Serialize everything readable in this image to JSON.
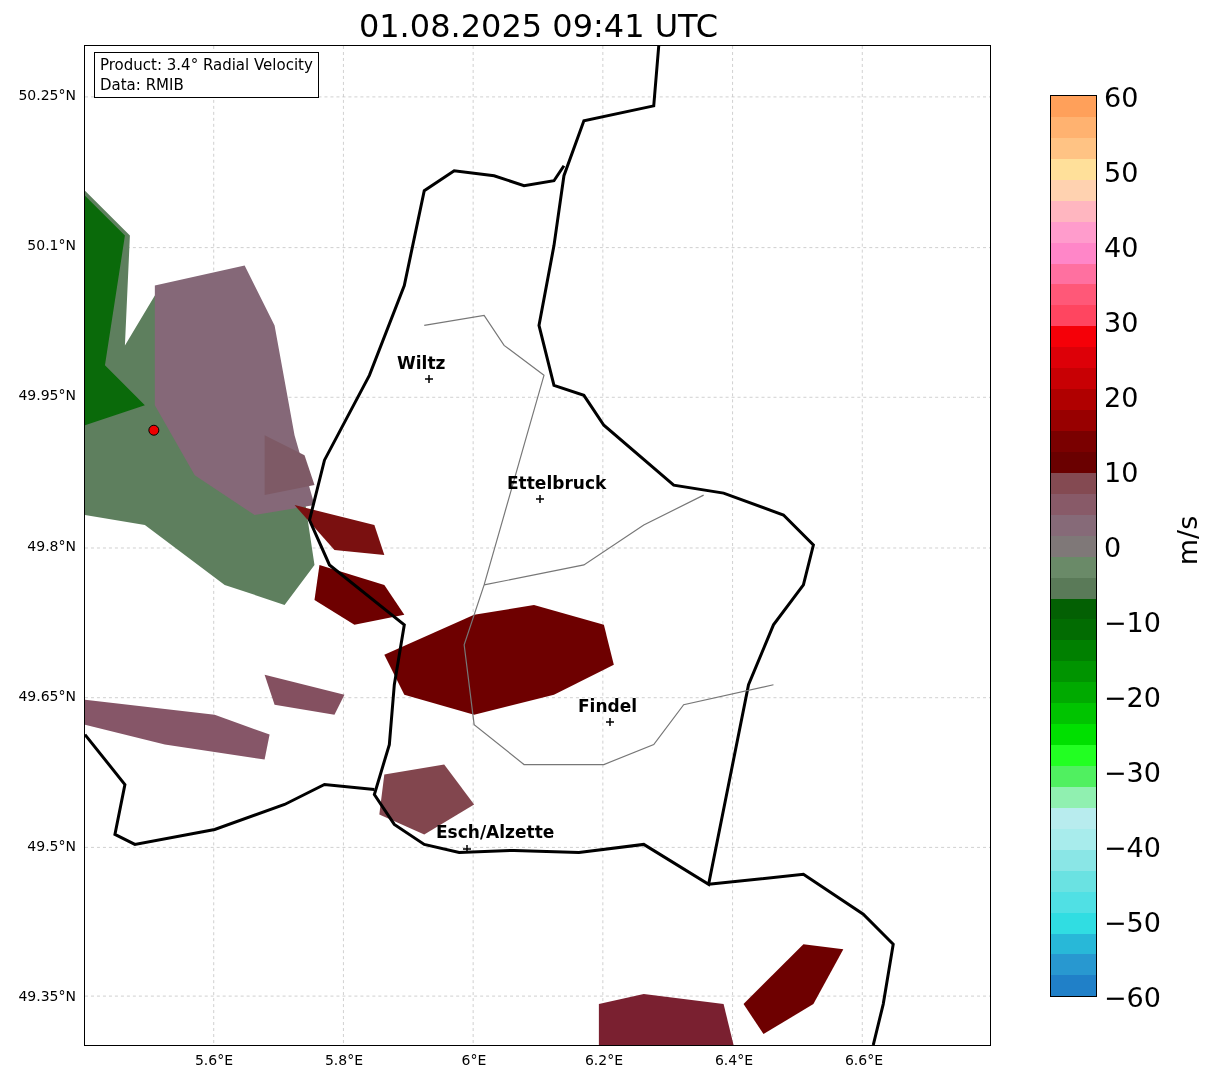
{
  "title": "01.08.2025 09:41 UTC",
  "legend": [
    "Product: 3.4° Radial Velocity",
    "Data: RMIB"
  ],
  "y_ticks": [
    "50.25°N",
    "50.1°N",
    "49.95°N",
    "49.8°N",
    "49.65°N",
    "49.5°N",
    "49.35°N"
  ],
  "x_ticks": [
    "5.6°E",
    "5.8°E",
    "6°E",
    "6.2°E",
    "6.4°E",
    "6.6°E"
  ],
  "cities": [
    {
      "name": "Wiltz"
    },
    {
      "name": "Ettelbruck"
    },
    {
      "name": "Findel"
    },
    {
      "name": "Esch/Alzette"
    }
  ],
  "colorbar": {
    "label": "m/s",
    "ticks": [
      "60",
      "50",
      "40",
      "30",
      "20",
      "10",
      "0",
      "−10",
      "−20",
      "−30",
      "−40",
      "−50",
      "−60"
    ],
    "bands": [
      {
        "color": "#ffa05a"
      },
      {
        "color": "#ffb270"
      },
      {
        "color": "#ffc384"
      },
      {
        "color": "#ffe09a"
      },
      {
        "color": "#ffd2b0"
      },
      {
        "color": "#ffb6c0"
      },
      {
        "color": "#ff9ccc"
      },
      {
        "color": "#ff86c8"
      },
      {
        "color": "#ff70a0"
      },
      {
        "color": "#ff5878"
      },
      {
        "color": "#ff4560"
      },
      {
        "color": "#f50008"
      },
      {
        "color": "#dd0008"
      },
      {
        "color": "#c80004"
      },
      {
        "color": "#b00000"
      },
      {
        "color": "#980000"
      },
      {
        "color": "#7a0000"
      },
      {
        "color": "#6a0000"
      },
      {
        "color": "#844a52"
      },
      {
        "color": "#885a68"
      },
      {
        "color": "#866a78"
      },
      {
        "color": "#7f7878"
      },
      {
        "color": "#6a8a68"
      },
      {
        "color": "#5a7a58"
      },
      {
        "color": "#036003"
      },
      {
        "color": "#026c02"
      },
      {
        "color": "#008000"
      },
      {
        "color": "#009400"
      },
      {
        "color": "#00aa00"
      },
      {
        "color": "#00c400"
      },
      {
        "color": "#00e000"
      },
      {
        "color": "#22ff22"
      },
      {
        "color": "#50f060"
      },
      {
        "color": "#90f0b0"
      },
      {
        "color": "#b8ecee"
      },
      {
        "color": "#a8ecec"
      },
      {
        "color": "#8ae6e6"
      },
      {
        "color": "#6ae2e2"
      },
      {
        "color": "#50e0e4"
      },
      {
        "color": "#30dde2"
      },
      {
        "color": "#28b8d8"
      },
      {
        "color": "#2898d0"
      },
      {
        "color": "#2080c8"
      }
    ]
  }
}
